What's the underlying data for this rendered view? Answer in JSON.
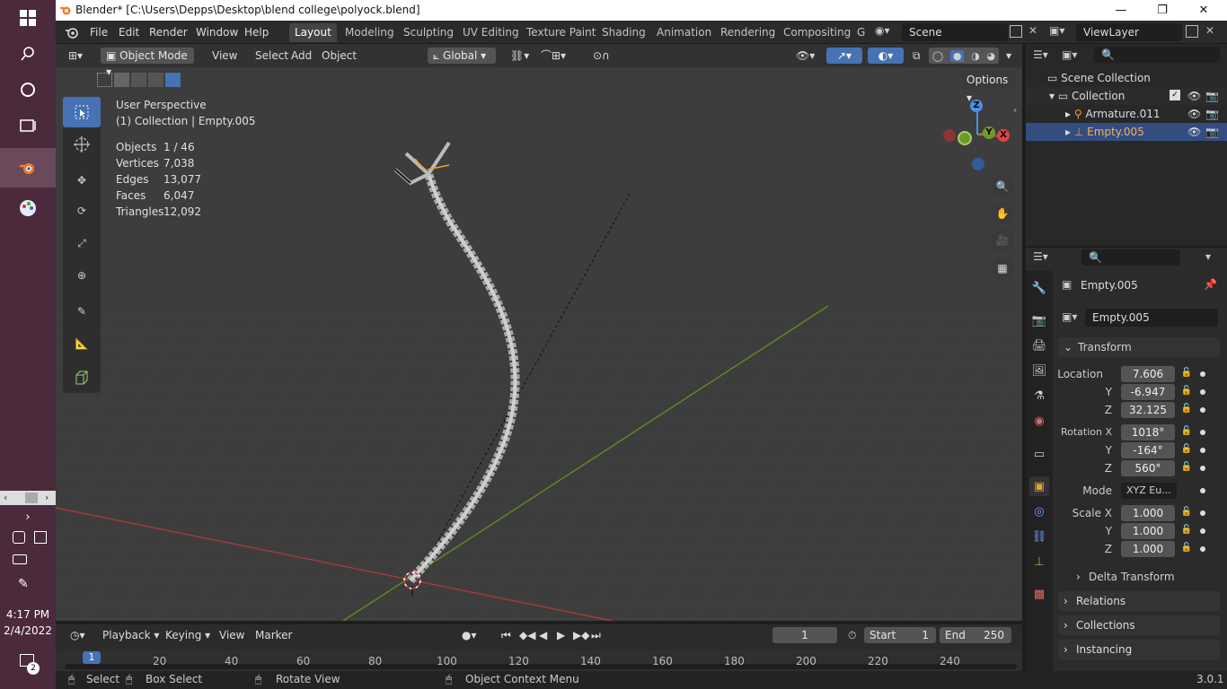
{
  "window": {
    "title": "Blender* [C:\\Users\\Depps\\Desktop\\blend college\\polyock.blend]",
    "minimize": "—",
    "restore": "❐",
    "close": "✕"
  },
  "taskbar": {
    "time": "4:17 PM",
    "date": "2/4/2022",
    "notif_count": "2"
  },
  "menus": [
    "File",
    "Edit",
    "Render",
    "Window",
    "Help"
  ],
  "workspaces": [
    "Layout",
    "Modeling",
    "Sculpting",
    "UV Editing",
    "Texture Paint",
    "Shading",
    "Animation",
    "Rendering",
    "Compositing",
    "G"
  ],
  "scene": "Scene",
  "view_layer": "ViewLayer",
  "viewport_header": {
    "mode": "Object Mode",
    "view": "View",
    "select": "Select",
    "add": "Add",
    "object": "Object",
    "transform_orientation": "Global",
    "options": "Options"
  },
  "overlay": {
    "perspective": "User Perspective",
    "collection": "(1) Collection | Empty.005",
    "stats": [
      {
        "label": "Objects",
        "value": "1 / 46"
      },
      {
        "label": "Vertices",
        "value": "7,038"
      },
      {
        "label": "Edges",
        "value": "13,077"
      },
      {
        "label": "Faces",
        "value": "6,047"
      },
      {
        "label": "Triangles",
        "value": "12,092"
      }
    ]
  },
  "gizmo": {
    "z": "Z",
    "y": "Y",
    "x": "X"
  },
  "outliner": {
    "scene_collection": "Scene Collection",
    "collection": "Collection",
    "items": [
      "Armature.011",
      "Empty.005"
    ]
  },
  "properties": {
    "object_name": "Empty.005",
    "datablock": "Empty.005",
    "transform": "Transform",
    "location_label": "Location",
    "location": [
      "7.606",
      "-6.947",
      "32.125"
    ],
    "rotation_label": "Rotation X",
    "rotation": [
      "1018°",
      "-164°",
      "560°"
    ],
    "mode_label": "Mode",
    "mode": "XYZ Eu...",
    "scale_label": "Scale X",
    "scale": [
      "1.000",
      "1.000",
      "1.000"
    ],
    "axis_y": "Y",
    "axis_z": "Z",
    "delta": "Delta Transform",
    "sections": [
      "Relations",
      "Collections",
      "Instancing"
    ]
  },
  "timeline": {
    "playback": "Playback",
    "keying": "Keying",
    "view": "View",
    "marker": "Marker",
    "current_frame": "1",
    "start_label": "Start",
    "start": "1",
    "end_label": "End",
    "end": "250",
    "ticks": [
      "1",
      "20",
      "40",
      "60",
      "80",
      "100",
      "120",
      "140",
      "160",
      "180",
      "200",
      "220",
      "240"
    ]
  },
  "statusbar": {
    "select": "Select",
    "box_select": "Box Select",
    "rotate": "Rotate View",
    "context": "Object Context Menu",
    "version": "3.0.1"
  },
  "colors": {
    "accent": "#4772b3",
    "x_axis": "#d84545",
    "y_axis": "#6f9a2a",
    "z_axis": "#4d8fe6",
    "origin": "#f0a030"
  }
}
